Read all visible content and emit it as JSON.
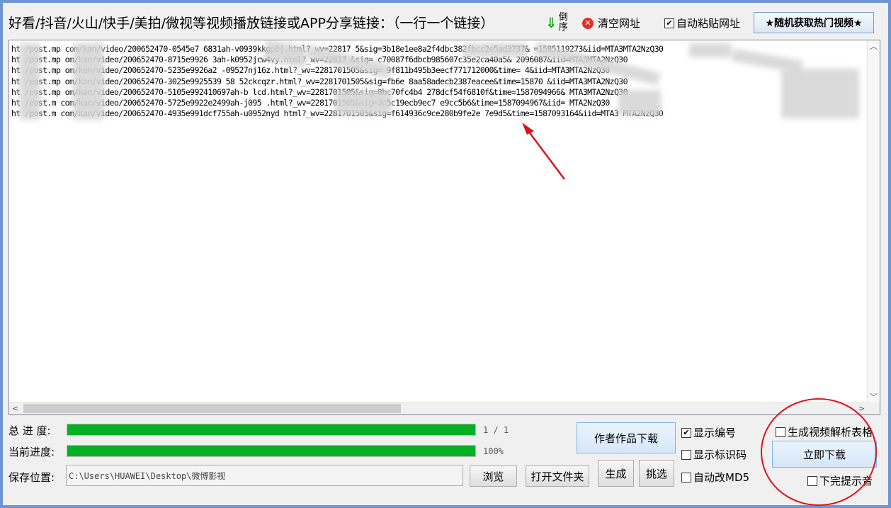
{
  "toolbar": {
    "title": "好看/抖音/火山/快手/美拍/微视等视频播放链接或APP分享链接：（一行一个链接）",
    "reverse_label": "倒序",
    "clear_label": "清空网址",
    "auto_paste_label": "自动粘贴网址",
    "auto_paste_checked": true,
    "hot_button_label": "★随机获取热门视频★"
  },
  "urls": [
    "ht     /post.mp     com/kan/video/200652470-0545e7      6831ah-v0939kkgp8j.html?_wv=22817       5&sig=3b18e1ee8a2f4dbc382fbcc2e5ad3737&        =1585119273&iid=MTA3MTA2NzQ30",
    "ht     /post.mp     om/kan/video/200652470-8715e9926      3ah-k0952jcw4vy.html?_wv=22817      &sig=     c70087f6dbcb985607c35e2ca40a5&        2096087&iid=MTA3MTA2NzQ30",
    "ht     /post.mp     om/kan/video/200652470-5235e9926a2      -09527nj16z.html?_wv=2281701505&sig=     9f811b495b3eecf771712000&time=        4&iid=MTA3MTA2NzQ30",
    "ht     /post.mp     om/kan/video/200652470-3025e9925539 58      52ckcqzr.html?_wv=2281701505&sig=fb6e       8aa58adecb2387eacee&time=15870       &iid=MTA3MTA2NzQ30",
    "ht     /post.mp     om/kan/video/200652470-5105e992410697ah-b      lcd.html?_wv=2281701505&sig=8bc70fc4b4     278dcf54f6810f&time=1587094966&       MTA3MTA2NzQ30",
    "ht     /post.m      com/kan/video/200652470-5725e9922e2499ah-j095      .html?_wv=2281701505&sig=3c5c19ecb9ec7     e9cc5b6&time=1587094967&iid=      MTA2NzQ30",
    "ht     /post.m      com/kan/video/200652470-4935e991dcf755ah-u0952nyd      html?_wv=2281701505&sig=f614936c9ce280b9fe2e      7e9d5&time=1587093164&iid=MTA3     MTA2NzQ30"
  ],
  "progress": {
    "total_label": "总 进 度:",
    "total_text": "1 / 1",
    "total_fraction": 1.0,
    "current_label": "当前进度:",
    "current_text": "100%",
    "current_fraction": 1.0
  },
  "save": {
    "label": "保存位置:",
    "path": "C:\\Users\\HUAWEI\\Desktop\\微博影视",
    "browse_label": "浏览",
    "open_folder_label": "打开文件夹"
  },
  "actions": {
    "author_download_label": "作者作品下载",
    "generate_label": "生成",
    "pick_label": "挑选",
    "download_now_label": "立即下载"
  },
  "options": {
    "show_number_label": "显示编号",
    "show_number_checked": true,
    "show_mark_label": "显示标识码",
    "show_mark_checked": false,
    "auto_md5_label": "自动改MD5",
    "auto_md5_checked": false,
    "gen_table_label": "生成视频解析表格",
    "gen_table_checked": false,
    "finish_sound_label": "下完提示音",
    "finish_sound_checked": false
  },
  "colors": {
    "progress_green": "#06b025",
    "annotation_red": "#d9141b"
  }
}
